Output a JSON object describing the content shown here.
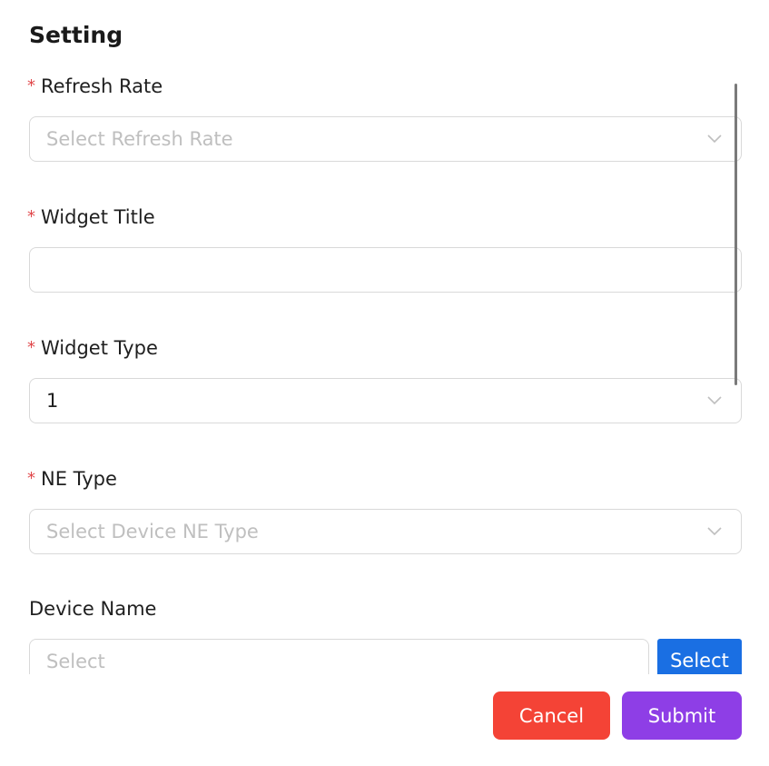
{
  "header": {
    "title": "Setting"
  },
  "fields": {
    "refresh_rate": {
      "label": "Refresh Rate",
      "required_mark": "*",
      "placeholder": "Select Refresh Rate",
      "value": ""
    },
    "widget_title": {
      "label": "Widget Title",
      "required_mark": "*",
      "value": ""
    },
    "widget_type": {
      "label": "Widget Type",
      "required_mark": "*",
      "value": "1"
    },
    "ne_type": {
      "label": "NE Type",
      "required_mark": "*",
      "placeholder": "Select Device NE Type",
      "value": ""
    },
    "device_name": {
      "label": "Device Name",
      "placeholder": "Select",
      "select_button": "Select"
    }
  },
  "footer": {
    "cancel_label": "Cancel",
    "submit_label": "Submit"
  },
  "colors": {
    "required": "#e0474a",
    "cancel": "#f44336",
    "submit": "#8e3ee6",
    "select_button": "#1a6fe3"
  },
  "icons": {
    "dropdown": "chevron-down-icon"
  }
}
